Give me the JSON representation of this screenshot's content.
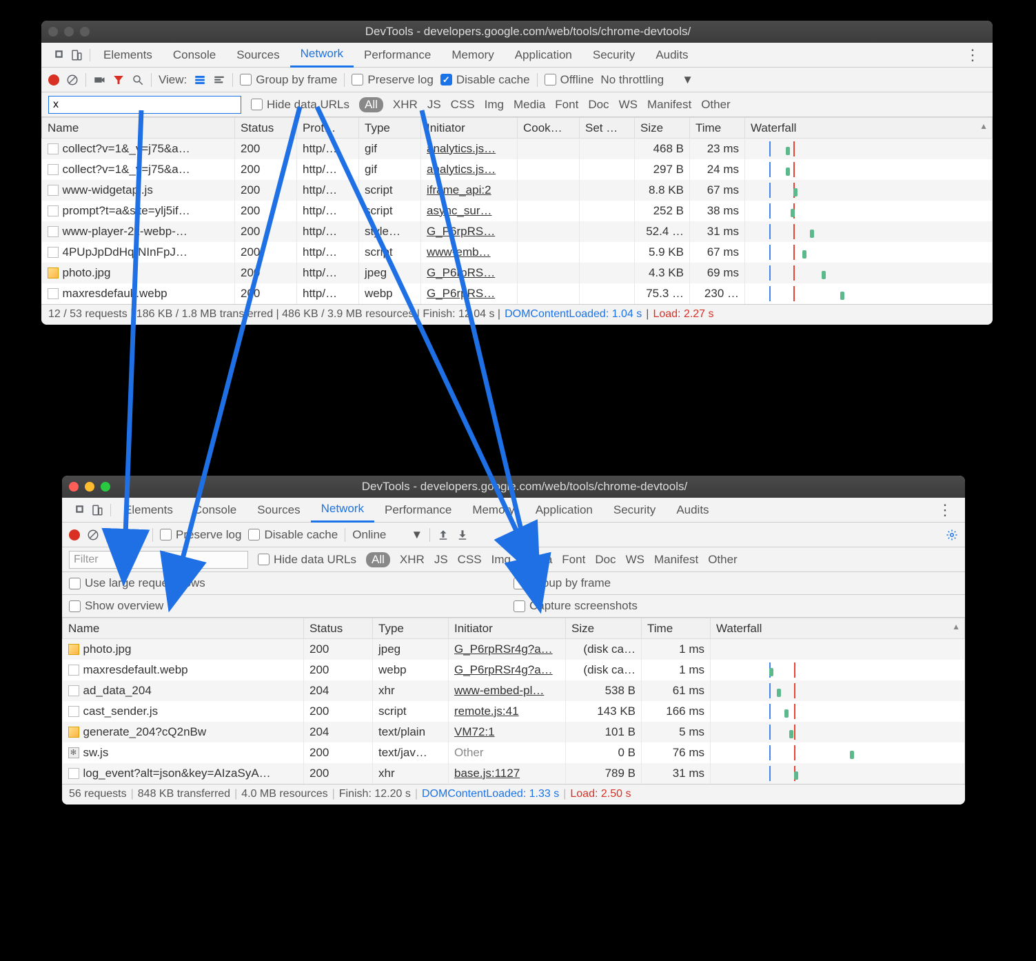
{
  "win1": {
    "title": "DevTools - developers.google.com/web/tools/chrome-devtools/",
    "tabs": [
      "Elements",
      "Console",
      "Sources",
      "Network",
      "Performance",
      "Memory",
      "Application",
      "Security",
      "Audits"
    ],
    "active_tab": "Network",
    "toolbar": {
      "view_label": "View:",
      "group_by_frame": "Group by frame",
      "preserve_log": "Preserve log",
      "disable_cache": "Disable cache",
      "offline": "Offline",
      "throttling": "No throttling"
    },
    "filter": {
      "input_value": "x",
      "hide_data_urls": "Hide data URLs",
      "types": [
        "All",
        "XHR",
        "JS",
        "CSS",
        "Img",
        "Media",
        "Font",
        "Doc",
        "WS",
        "Manifest",
        "Other"
      ]
    },
    "columns": [
      "Name",
      "Status",
      "Prot…",
      "Type",
      "Initiator",
      "Cook…",
      "Set …",
      "Size",
      "Time",
      "Waterfall"
    ],
    "rows": [
      {
        "name": "collect?v=1&_v=j75&a…",
        "status": "200",
        "proto": "http/…",
        "type": "gif",
        "initiator": "analytics.js…",
        "cook": "",
        "set": "",
        "size": "468 B",
        "time": "23 ms",
        "wf": 5
      },
      {
        "name": "collect?v=1&_v=j75&a…",
        "status": "200",
        "proto": "http/…",
        "type": "gif",
        "initiator": "analytics.js…",
        "cook": "",
        "set": "",
        "size": "297 B",
        "time": "24 ms",
        "wf": 5
      },
      {
        "name": "www-widgetapi.js",
        "status": "200",
        "proto": "http/…",
        "type": "script",
        "initiator": "iframe_api:2",
        "cook": "",
        "set": "",
        "size": "8.8 KB",
        "time": "67 ms",
        "wf": 8
      },
      {
        "name": "prompt?t=a&site=ylj5if…",
        "status": "200",
        "proto": "http/…",
        "type": "script",
        "initiator": "async_sur…",
        "cook": "",
        "set": "",
        "size": "252 B",
        "time": "38 ms",
        "wf": 7
      },
      {
        "name": "www-player-2x-webp-…",
        "status": "200",
        "proto": "http/…",
        "type": "style…",
        "initiator": "G_P6rpRS…",
        "cook": "",
        "set": "",
        "size": "52.4 …",
        "time": "31 ms",
        "wf": 15
      },
      {
        "name": "4PUpJpDdHqrNInFpJ…",
        "status": "200",
        "proto": "http/…",
        "type": "script",
        "initiator": "www-emb…",
        "cook": "",
        "set": "",
        "size": "5.9 KB",
        "time": "67 ms",
        "wf": 12
      },
      {
        "name": "photo.jpg",
        "status": "200",
        "proto": "http/…",
        "type": "jpeg",
        "initiator": "G_P6rpRS…",
        "cook": "",
        "set": "",
        "size": "4.3 KB",
        "time": "69 ms",
        "wf": 20,
        "icon": "img"
      },
      {
        "name": "maxresdefault.webp",
        "status": "200",
        "proto": "http/…",
        "type": "webp",
        "initiator": "G_P6rpRS…",
        "cook": "",
        "set": "",
        "size": "75.3 …",
        "time": "230 …",
        "wf": 28
      }
    ],
    "status_bar": {
      "text": "12 / 53 requests | 186 KB / 1.8 MB transferred | 486 KB / 3.9 MB resources | Finish: 12.04 s | ",
      "dcl": "DOMContentLoaded: 1.04 s",
      "sep": " | ",
      "load": "Load: 2.27 s"
    }
  },
  "win2": {
    "title": "DevTools - developers.google.com/web/tools/chrome-devtools/",
    "tabs": [
      "Elements",
      "Console",
      "Sources",
      "Network",
      "Performance",
      "Memory",
      "Application",
      "Security",
      "Audits"
    ],
    "active_tab": "Network",
    "toolbar": {
      "preserve_log": "Preserve log",
      "disable_cache": "Disable cache",
      "online": "Online"
    },
    "filter": {
      "placeholder": "Filter",
      "hide_data_urls": "Hide data URLs",
      "types": [
        "All",
        "XHR",
        "JS",
        "CSS",
        "Img",
        "Media",
        "Font",
        "Doc",
        "WS",
        "Manifest",
        "Other"
      ]
    },
    "settings": {
      "large_rows": "Use large request rows",
      "group_by_frame": "Group by frame",
      "show_overview": "Show overview",
      "capture_screenshots": "Capture screenshots"
    },
    "columns": [
      "Name",
      "Status",
      "Type",
      "Initiator",
      "Size",
      "Time",
      "Waterfall"
    ],
    "partial_row": {
      "name": "photo.jpg",
      "status": "200",
      "type": "jpeg",
      "initiator": "G_P6rpRSr4g?a…",
      "size": "(disk ca…",
      "time": "1 ms"
    },
    "rows": [
      {
        "name": "maxresdefault.webp",
        "status": "200",
        "type": "webp",
        "initiator": "G_P6rpRSr4g?a…",
        "size": "(disk ca…",
        "time": "1 ms",
        "wf": 22,
        "gray": true
      },
      {
        "name": "ad_data_204",
        "status": "204",
        "type": "xhr",
        "initiator": "www-embed-pl…",
        "size": "538 B",
        "time": "61 ms",
        "wf": 25
      },
      {
        "name": "cast_sender.js",
        "status": "200",
        "type": "script",
        "initiator": "remote.js:41",
        "size": "143 KB",
        "time": "166 ms",
        "wf": 28
      },
      {
        "name": "generate_204?cQ2nBw",
        "status": "204",
        "type": "text/plain",
        "initiator": "VM72:1",
        "size": "101 B",
        "time": "5 ms",
        "wf": 30,
        "icon": "img"
      },
      {
        "name": "sw.js",
        "status": "200",
        "type": "text/jav…",
        "initiator": "Other",
        "size": "0 B",
        "time": "76 ms",
        "wf": 55,
        "icon": "gear",
        "grayinit": true
      },
      {
        "name": "log_event?alt=json&key=AIzaSyA…",
        "status": "200",
        "type": "xhr",
        "initiator": "base.js:1127",
        "size": "789 B",
        "time": "31 ms",
        "wf": 32
      }
    ],
    "status_bar": {
      "parts": [
        "56 requests",
        "848 KB transferred",
        "4.0 MB resources",
        "Finish: 12.20 s"
      ],
      "dcl": "DOMContentLoaded: 1.33 s",
      "load": "Load: 2.50 s"
    }
  }
}
